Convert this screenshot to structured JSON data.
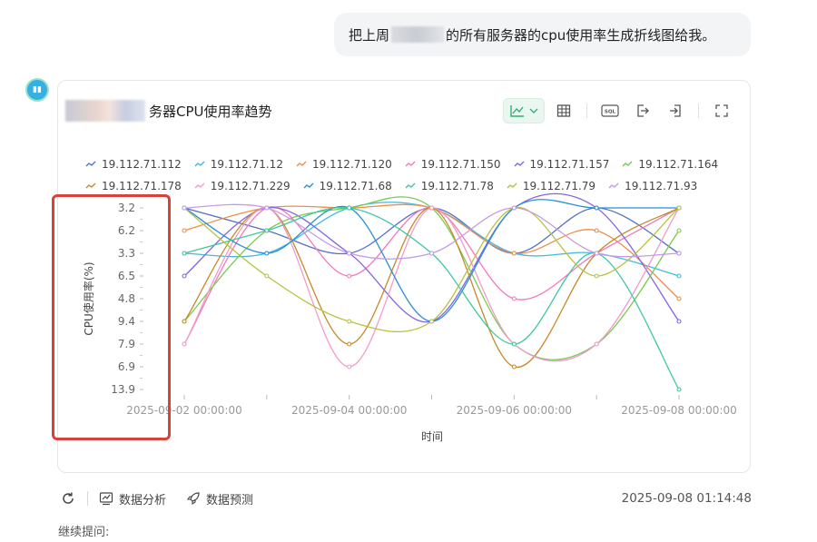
{
  "user_message": {
    "before": "把上周",
    "after": "的所有服务器的cpu使用率生成折线图给我。"
  },
  "card": {
    "title_suffix": "务器CPU使用率趋势",
    "toolbar": {
      "line_chart": "line-chart-icon",
      "table": "table-icon",
      "sql": "SQL",
      "export": "export-icon",
      "import": "import-icon",
      "fullscreen": "fullscreen-icon"
    }
  },
  "footer": {
    "analysis_label": "数据分析",
    "predict_label": "数据预测",
    "timestamp": "2025-09-08 01:14:48"
  },
  "followup_label": "继续提问:",
  "colors": {
    "accent": "#2fae73",
    "highlight": "#d6433a"
  },
  "chart_data": {
    "type": "line",
    "title": "",
    "xlabel": "时间",
    "ylabel": "CPU使用率(%)",
    "y_categories": [
      "3.2",
      "6.2",
      "3.3",
      "6.5",
      "4.8",
      "9.4",
      "7.9",
      "6.9",
      "13.9"
    ],
    "x_tick_labels": [
      "2025-09-02 00:00:00",
      "2025-09-04 00:00:00",
      "2025-09-06 00:00:00",
      "2025-09-08 00:00:00"
    ],
    "x": [
      "2025-09-02",
      "2025-09-03",
      "2025-09-04",
      "2025-09-05",
      "2025-09-06",
      "2025-09-07",
      "2025-09-08"
    ],
    "series": [
      {
        "name": "19.112.71.112",
        "color": "#5470c6",
        "values": [
          3.2,
          6.2,
          3.3,
          3.2,
          3.3,
          3.2,
          3.3
        ]
      },
      {
        "name": "19.112.71.12",
        "color": "#41b9e0",
        "values": [
          3.3,
          3.3,
          4.9,
          3.2,
          3.3,
          3.3,
          6.5
        ]
      },
      {
        "name": "19.112.71.120",
        "color": "#ee8d4b",
        "values": [
          6.2,
          3.2,
          3.2,
          3.2,
          3.3,
          6.2,
          4.8
        ]
      },
      {
        "name": "19.112.71.150",
        "color": "#f279c0",
        "values": [
          7.9,
          3.2,
          6.5,
          3.2,
          4.8,
          3.3,
          3.2
        ]
      },
      {
        "name": "19.112.71.157",
        "color": "#8463e8",
        "values": [
          6.5,
          4.9,
          3.3,
          9.4,
          3.2,
          3.2,
          9.4
        ]
      },
      {
        "name": "19.112.71.164",
        "color": "#7ac94f",
        "values": [
          9.4,
          6.2,
          3.2,
          4.9,
          7.9,
          7.9,
          6.2
        ]
      },
      {
        "name": "19.112.71.178",
        "color": "#c48a2a",
        "values": [
          9.4,
          3.2,
          7.9,
          3.2,
          6.9,
          3.3,
          3.2
        ]
      },
      {
        "name": "19.112.71.229",
        "color": "#f29ac9",
        "values": [
          7.9,
          3.2,
          6.9,
          3.2,
          7.9,
          7.9,
          3.2
        ]
      },
      {
        "name": "19.112.71.68",
        "color": "#2b8fd6",
        "values": [
          3.2,
          3.3,
          3.2,
          9.4,
          3.2,
          3.2,
          3.2
        ]
      },
      {
        "name": "19.112.71.78",
        "color": "#3fc7a0",
        "values": [
          3.3,
          6.2,
          4.9,
          3.3,
          7.9,
          3.3,
          13.9
        ]
      },
      {
        "name": "19.112.71.79",
        "color": "#b7c33d",
        "values": [
          3.2,
          6.5,
          9.4,
          9.4,
          3.2,
          6.5,
          3.2
        ]
      },
      {
        "name": "19.112.71.93",
        "color": "#c69ae6",
        "values": [
          3.2,
          3.2,
          3.3,
          3.3,
          3.2,
          3.3,
          3.3
        ]
      }
    ],
    "grid": false,
    "legend_placement": "top"
  }
}
